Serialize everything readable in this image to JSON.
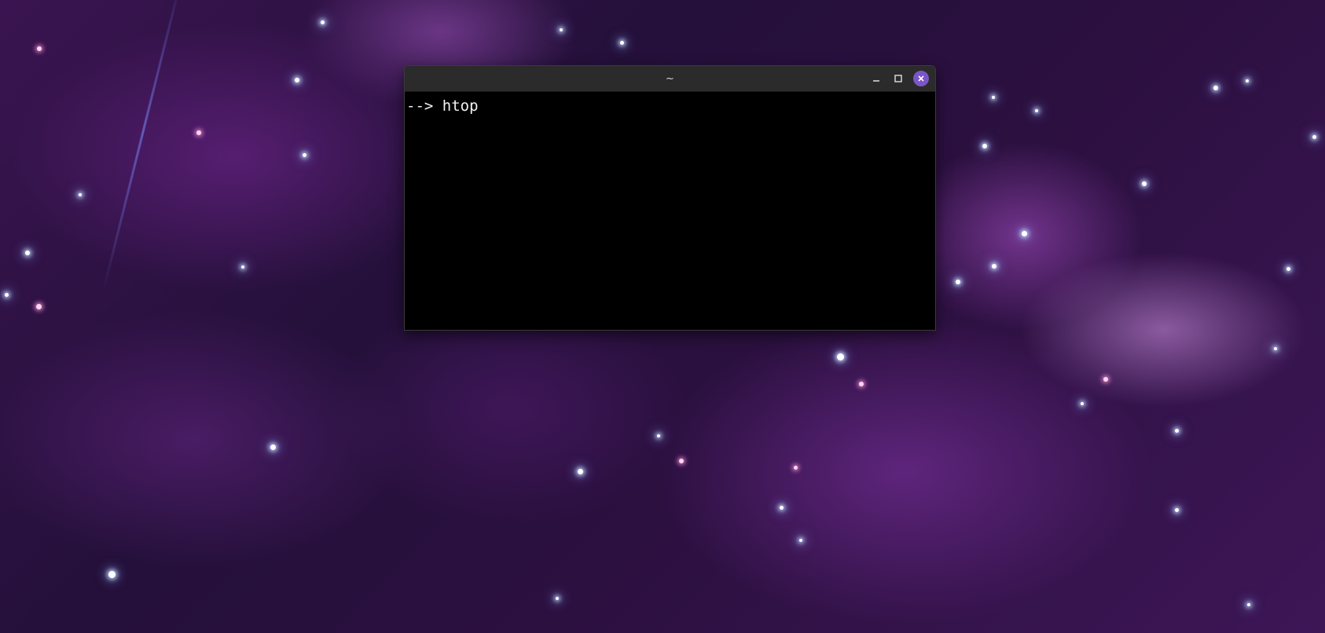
{
  "desktop": {
    "wallpaper": "purple-nebula-starfield",
    "accent": "#7b55c8"
  },
  "window": {
    "title": "~",
    "controls": {
      "minimize_icon": "minimize-icon",
      "maximize_icon": "maximize-icon",
      "close_icon": "close-icon"
    }
  },
  "terminal": {
    "prompt": "-->",
    "command": "htop"
  }
}
